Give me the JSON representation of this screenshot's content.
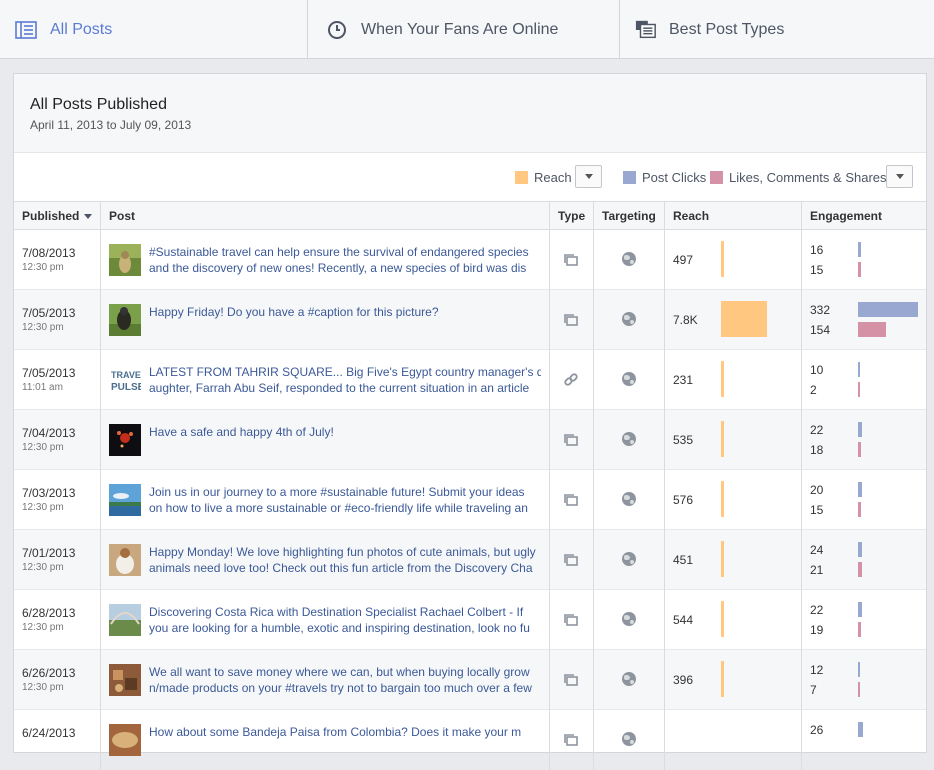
{
  "tabs": [
    {
      "label": "All Posts"
    },
    {
      "label": "When Your Fans Are Online"
    },
    {
      "label": "Best Post Types"
    }
  ],
  "panel": {
    "title": "All Posts Published",
    "range": "April 11, 2013 to July 09, 2013"
  },
  "legend": {
    "reach": "Reach",
    "post_clicks": "Post Clicks",
    "likes": "Likes, Comments & Shares",
    "colors": {
      "reach": "#ffc77f",
      "post_clicks": "#98a8d0",
      "likes": "#d591a6"
    }
  },
  "table": {
    "headers": {
      "published": "Published",
      "post": "Post",
      "type": "Type",
      "targeting": "Targeting",
      "reach": "Reach",
      "engagement": "Engagement"
    },
    "rows": [
      {
        "date": "7/08/2013",
        "time": "12:30 pm",
        "line1": "#Sustainable travel can help ensure the survival of endangered species",
        "line2": "and the discovery of new ones! Recently, a new species of bird was dis",
        "type": "photo",
        "reach": "497",
        "reach_value": 497,
        "clicks": "16",
        "likes": "15",
        "clicks_value": 16,
        "likes_value": 15
      },
      {
        "date": "7/05/2013",
        "time": "12:30 pm",
        "line1": "Happy Friday! Do you have a #caption for this picture?",
        "line2": "",
        "type": "photo",
        "reach": "7.8K",
        "reach_value": 7800,
        "clicks": "332",
        "likes": "154",
        "clicks_value": 332,
        "likes_value": 154
      },
      {
        "date": "7/05/2013",
        "time": "11:01 am",
        "line1": "LATEST FROM TAHRIR SQUARE... Big Five's Egypt country manager's d",
        "line2": "aughter, Farrah Abu Seif, responded to the current situation in an article",
        "type": "link",
        "reach": "231",
        "reach_value": 231,
        "clicks": "10",
        "likes": "2",
        "clicks_value": 10,
        "likes_value": 2
      },
      {
        "date": "7/04/2013",
        "time": "12:30 pm",
        "line1": "Have a safe and happy 4th of July!",
        "line2": "",
        "type": "photo",
        "reach": "535",
        "reach_value": 535,
        "clicks": "22",
        "likes": "18",
        "clicks_value": 22,
        "likes_value": 18
      },
      {
        "date": "7/03/2013",
        "time": "12:30 pm",
        "line1": "Join us in our journey to a more #sustainable future! Submit your ideas",
        "line2": "on how to live a more sustainable or #eco-friendly life while traveling an",
        "type": "photo",
        "reach": "576",
        "reach_value": 576,
        "clicks": "20",
        "likes": "15",
        "clicks_value": 20,
        "likes_value": 15
      },
      {
        "date": "7/01/2013",
        "time": "12:30 pm",
        "line1": "Happy Monday! We love highlighting fun photos of cute animals, but ugly",
        "line2": "animals need love too! Check out this fun article from the Discovery Cha",
        "type": "photo",
        "reach": "451",
        "reach_value": 451,
        "clicks": "24",
        "likes": "21",
        "clicks_value": 24,
        "likes_value": 21
      },
      {
        "date": "6/28/2013",
        "time": "12:30 pm",
        "line1": "Discovering Costa Rica with Destination Specialist Rachael Colbert - If",
        "line2": "you are looking for a humble, exotic and inspiring destination, look no fu",
        "type": "photo",
        "reach": "544",
        "reach_value": 544,
        "clicks": "22",
        "likes": "19",
        "clicks_value": 22,
        "likes_value": 19
      },
      {
        "date": "6/26/2013",
        "time": "12:30 pm",
        "line1": "We all want to save money where we can, but when buying locally grow",
        "line2": "n/made products on your #travels try not to bargain too much over a few",
        "type": "photo",
        "reach": "396",
        "reach_value": 396,
        "clicks": "12",
        "likes": "7",
        "clicks_value": 12,
        "likes_value": 7
      },
      {
        "date": "6/24/2013",
        "time": "",
        "line1": "How about some Bandeja Paisa from Colombia? Does it make your m",
        "line2": "",
        "type": "photo",
        "reach": "",
        "reach_value": 0,
        "clicks": "26",
        "likes": "",
        "clicks_value": 26,
        "likes_value": 0
      }
    ]
  }
}
